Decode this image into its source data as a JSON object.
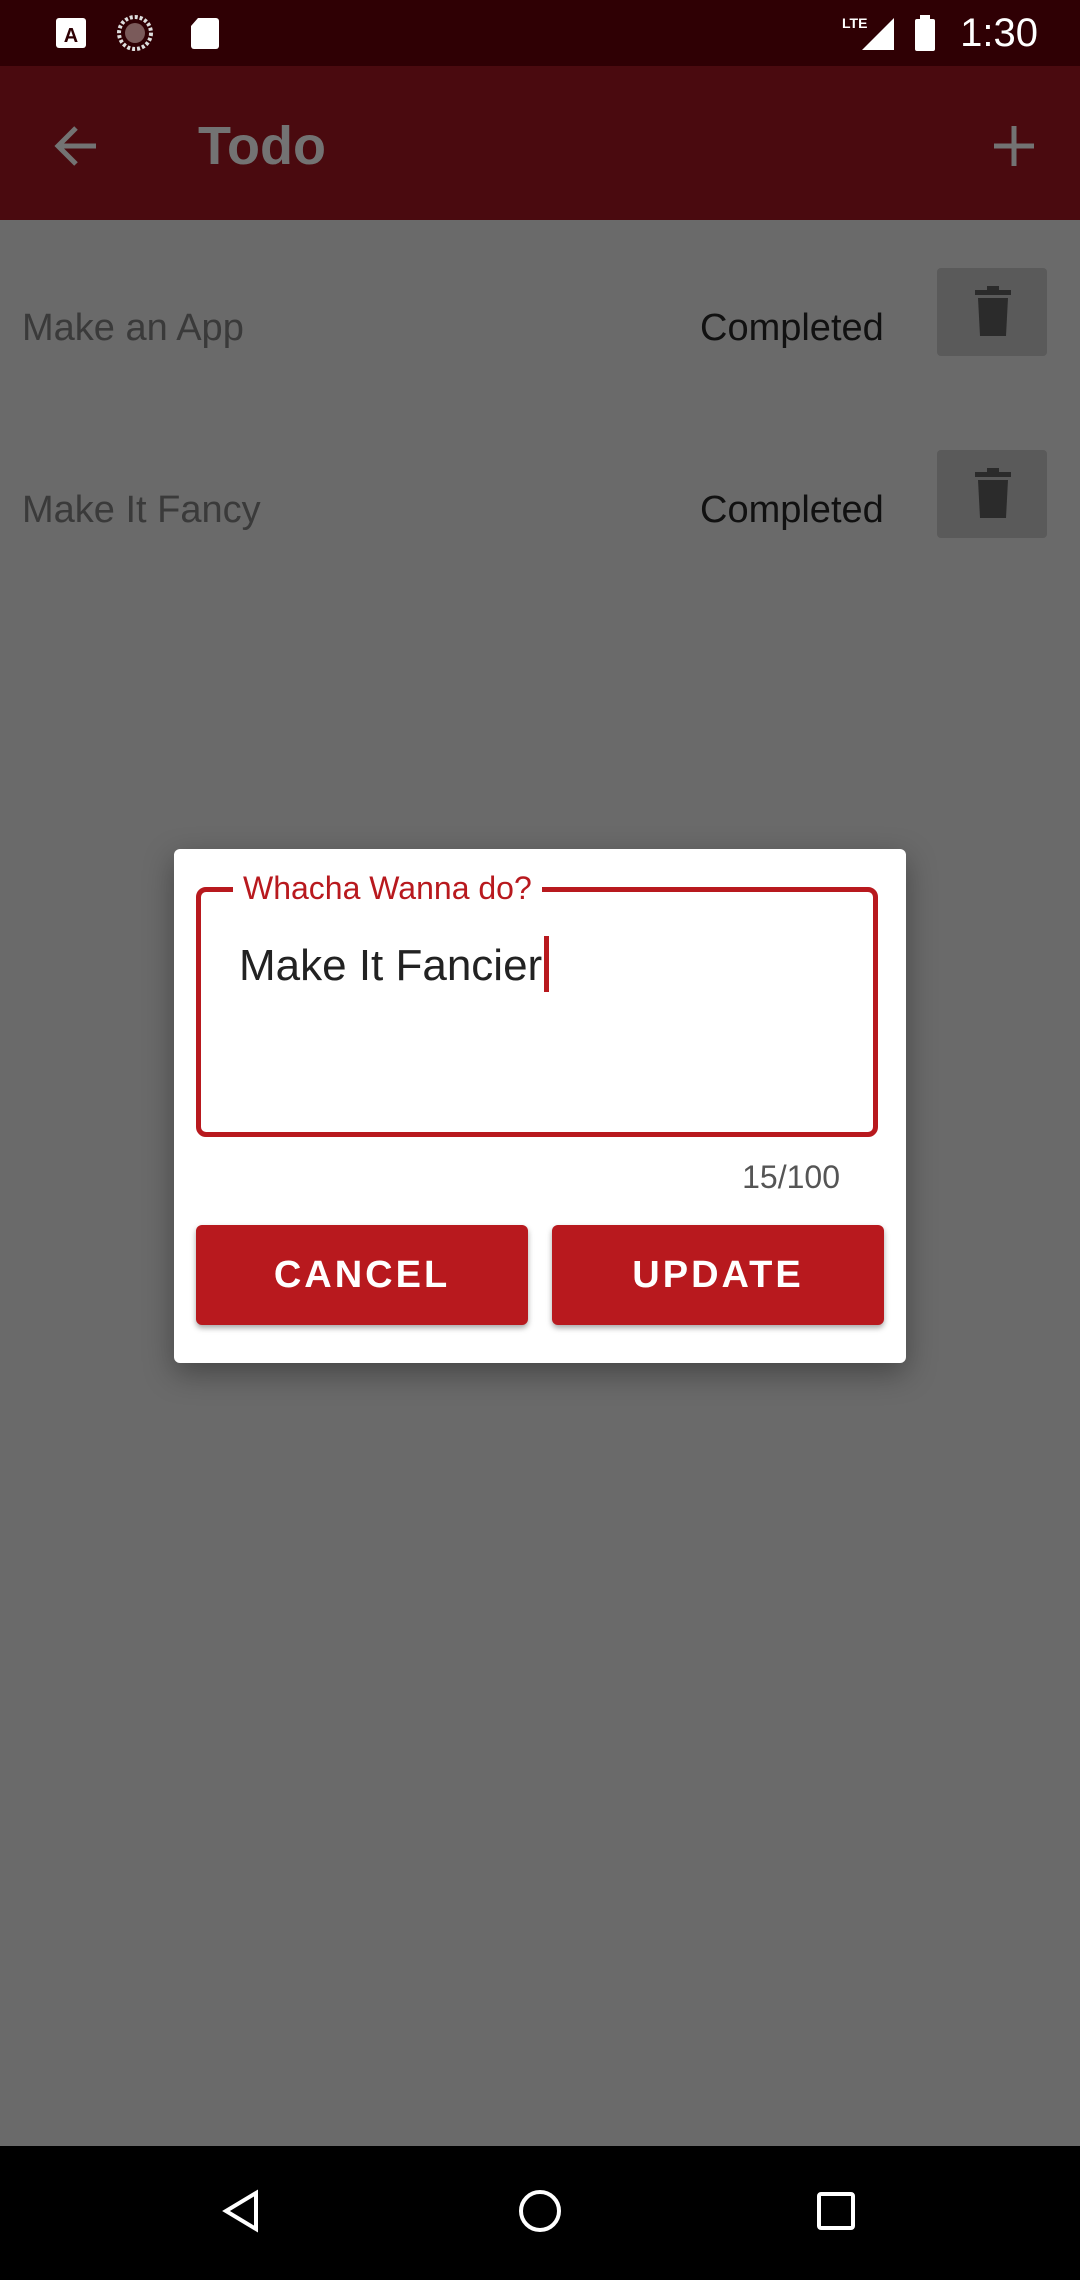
{
  "status_bar": {
    "left_icons": [
      "a-notification-icon",
      "loading-circle-icon",
      "sd-card-icon"
    ],
    "network": "LTE",
    "time": "1:30"
  },
  "app_bar": {
    "title": "Todo",
    "back_icon": "arrow-left-icon",
    "add_icon": "plus-icon"
  },
  "todos": [
    {
      "label": "Make an App",
      "status": "Completed",
      "delete_icon": "trash-icon"
    },
    {
      "label": "Make It Fancy",
      "status": "Completed",
      "delete_icon": "trash-icon"
    }
  ],
  "dialog": {
    "field_label": "Whacha Wanna do?",
    "field_value": "Make It Fancier",
    "counter": "15/100",
    "cancel_label": "CANCEL",
    "update_label": "UPDATE"
  },
  "colors": {
    "accent": "#b8191e",
    "app_bar": "#4a0a0f",
    "status_bar": "#2f0004"
  }
}
